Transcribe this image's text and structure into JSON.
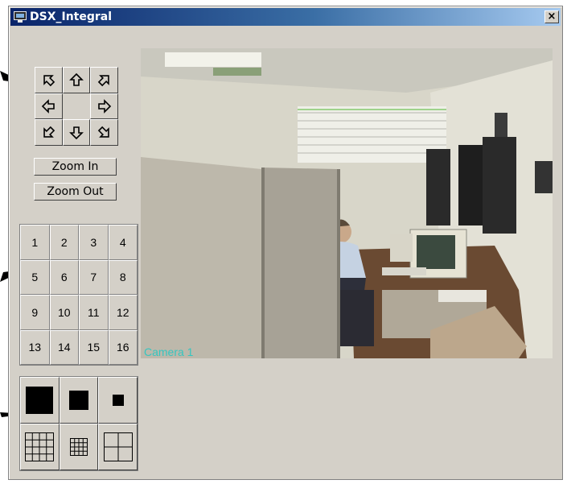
{
  "window": {
    "title": "DSX_Integral",
    "close_glyph": "×"
  },
  "ptz": {
    "arrows": [
      {
        "name": "pan-up-left-icon",
        "dir": "up-left"
      },
      {
        "name": "tilt-up-icon",
        "dir": "up"
      },
      {
        "name": "pan-up-right-icon",
        "dir": "up-right"
      },
      {
        "name": "pan-left-icon",
        "dir": "left"
      },
      {
        "name": "center",
        "dir": "none"
      },
      {
        "name": "pan-right-icon",
        "dir": "right"
      },
      {
        "name": "pan-down-left-icon",
        "dir": "down-left"
      },
      {
        "name": "tilt-down-icon",
        "dir": "down"
      },
      {
        "name": "pan-down-right-icon",
        "dir": "down-right"
      }
    ],
    "zoom_in": "Zoom In",
    "zoom_out": "Zoom Out"
  },
  "cameras": [
    "1",
    "2",
    "3",
    "4",
    "5",
    "6",
    "7",
    "8",
    "9",
    "10",
    "11",
    "12",
    "13",
    "14",
    "15",
    "16"
  ],
  "layouts": [
    {
      "name": "single-large-view-icon"
    },
    {
      "name": "single-medium-view-icon"
    },
    {
      "name": "single-small-view-icon"
    },
    {
      "name": "grid-4x4-view-icon"
    },
    {
      "name": "grid-3x3-view-icon"
    },
    {
      "name": "grid-2x2-view-icon"
    }
  ],
  "video": {
    "label": "Camera 1"
  },
  "colors": {
    "title_start": "#0a246a",
    "title_end": "#a6caf0",
    "face": "#d4d0c8",
    "camera_label": "#35c6c0"
  }
}
